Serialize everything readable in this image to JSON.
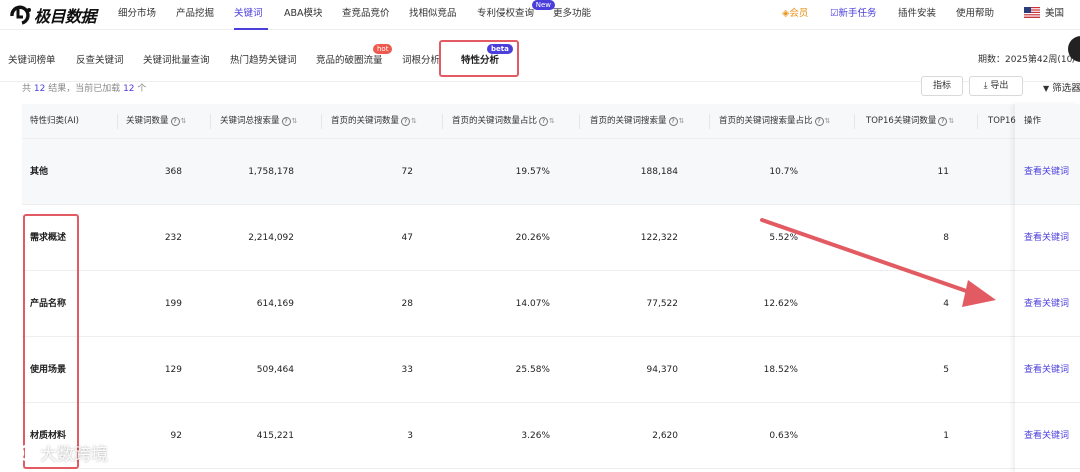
{
  "brand": {
    "logo_text": "极目数据"
  },
  "topnav": {
    "items": [
      {
        "label": "细分市场"
      },
      {
        "label": "产品挖掘"
      },
      {
        "label": "关键词",
        "active": true
      },
      {
        "label": "ABA模块"
      },
      {
        "label": "查竞品竞价"
      },
      {
        "label": "找相似竞品"
      },
      {
        "label": "专利侵权查询",
        "badge": "New"
      },
      {
        "label": "更多功能"
      }
    ],
    "vip_label": "会员",
    "task_label": "新手任务",
    "plugin_label": "插件安装",
    "help_label": "使用帮助",
    "region_label": "美国"
  },
  "subtabs": {
    "items": [
      {
        "label": "关键词榜单"
      },
      {
        "label": "反查关键词"
      },
      {
        "label": "关键词批量查询"
      },
      {
        "label": "热门趋势关键词"
      },
      {
        "label": "竞品的破圈流量",
        "badge": "hot"
      },
      {
        "label": "词根分析"
      },
      {
        "label": "特性分析",
        "badge": "beta",
        "active": true
      }
    ],
    "period_label": "期数：2025第42周(10/"
  },
  "toolbar": {
    "result_prefix": "共 ",
    "result_total": "12",
    "result_mid": " 结果，当前已加载 ",
    "result_loaded": "12",
    "result_suffix": " 个",
    "metric_button": "指标",
    "export_button": "导出",
    "filter_button": "筛选器"
  },
  "table": {
    "headers": [
      "特性归类(AI)",
      "关键词数量",
      "关键词总搜索量",
      "首页的关键词数量",
      "首页的关键词数量占比",
      "首页的关键词搜索量",
      "首页的关键词搜索量占比",
      "TOP16关键词数量",
      "TOP16",
      "操作"
    ],
    "rows": [
      [
        "其他",
        "368",
        "1,758,178",
        "72",
        "19.57%",
        "188,184",
        "10.7%",
        "11",
        "查看关键词"
      ],
      [
        "需求概述",
        "232",
        "2,214,092",
        "47",
        "20.26%",
        "122,322",
        "5.52%",
        "8",
        "查看关键词"
      ],
      [
        "产品名称",
        "199",
        "614,169",
        "28",
        "14.07%",
        "77,522",
        "12.62%",
        "4",
        "查看关键词"
      ],
      [
        "使用场景",
        "129",
        "509,464",
        "33",
        "25.58%",
        "94,370",
        "18.52%",
        "5",
        "查看关键词"
      ],
      [
        "材质材料",
        "92",
        "415,221",
        "3",
        "3.26%",
        "2,620",
        "0.63%",
        "1",
        "查看关键词"
      ]
    ]
  },
  "watermark": {
    "text": "大数跨境"
  },
  "colors": {
    "accent": "#4b3fdc",
    "annotation_red": "#e25b63",
    "vip": "#e89216"
  }
}
